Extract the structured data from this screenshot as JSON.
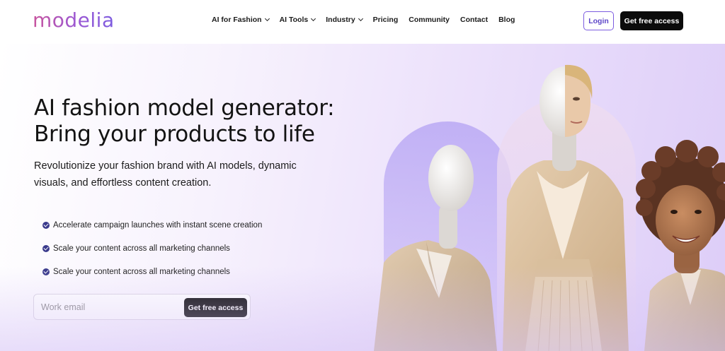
{
  "brand": {
    "logo_text": "modelia"
  },
  "nav": {
    "items": [
      {
        "label": "AI for Fashion",
        "has_dropdown": true
      },
      {
        "label": "AI Tools",
        "has_dropdown": true
      },
      {
        "label": "Industry",
        "has_dropdown": true
      },
      {
        "label": "Pricing",
        "has_dropdown": false
      },
      {
        "label": "Community",
        "has_dropdown": false
      },
      {
        "label": "Contact",
        "has_dropdown": false
      },
      {
        "label": "Blog",
        "has_dropdown": false
      }
    ],
    "login_label": "Login",
    "cta_label": "Get free access"
  },
  "hero": {
    "headline_line1": "AI fashion model generator:",
    "headline_line2": "Bring your products to life",
    "subhead": "Revolutionize your fashion brand with AI models, dynamic visuals, and effortless content creation.",
    "bullets": [
      "Accelerate campaign launches with instant scene creation",
      "Scale your content across all marketing channels",
      "Scale your content across all marketing channels"
    ],
    "email_placeholder": "Work email",
    "email_cta_label": "Get free access"
  },
  "colors": {
    "accent": "#7c5ce0",
    "cta_bg": "#0b0b0b",
    "check": "#3a3a8c",
    "hero_gradient_end": "#ddcdf8"
  }
}
